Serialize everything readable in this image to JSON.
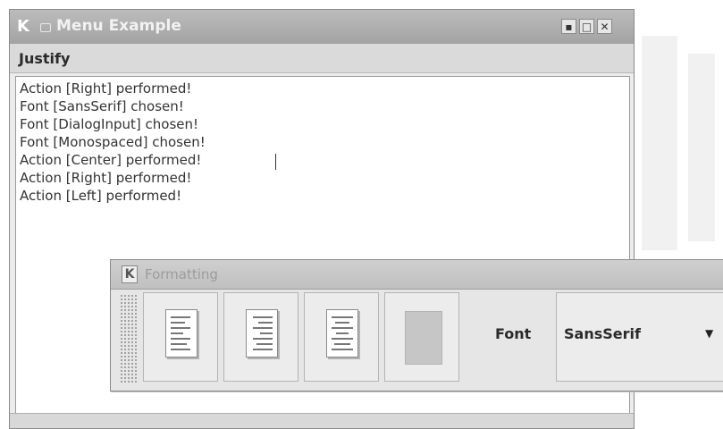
{
  "main_window": {
    "title": "Menu Example",
    "logo": "K",
    "menu": {
      "justify": "Justify"
    },
    "controls": {
      "minimize": "▪",
      "maximize": "□",
      "close": "✕"
    },
    "log_lines": [
      "Action [Right] performed!",
      "Font [SansSerif] chosen!",
      "Font [DialogInput] chosen!",
      "Font [Monospaced] chosen!",
      "Action [Center] performed!",
      "Action [Right] performed!",
      "Action [Left] performed!"
    ]
  },
  "toolbar_window": {
    "title": "Formatting",
    "logo": "K",
    "close": "✕",
    "buttons": [
      {
        "name": "align-left-icon"
      },
      {
        "name": "align-right-icon"
      },
      {
        "name": "align-center-icon"
      },
      {
        "name": "color-swatch"
      }
    ],
    "font_label": "Font",
    "font_combo": {
      "selected": "SansSerif",
      "arrow": "▼"
    }
  },
  "colors": {
    "titlebar": "#a8a8a8",
    "menubar": "#dadada",
    "text": "#333333",
    "swatch": "#c6c6c6"
  }
}
